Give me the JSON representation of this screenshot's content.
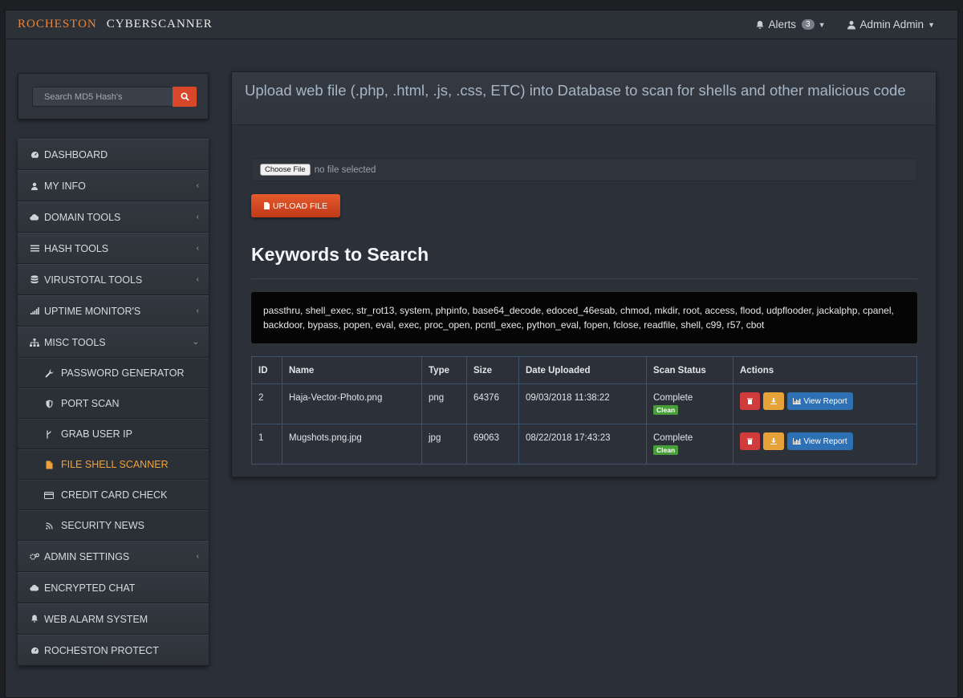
{
  "brand": {
    "part1": "ROCHESTON",
    "part2": "CYBERSCANNER"
  },
  "navbar": {
    "alerts_label": "Alerts",
    "alerts_count": "3",
    "user_label": "Admin Admin"
  },
  "search": {
    "placeholder": "Search MD5 Hash's"
  },
  "sidebar": {
    "items": [
      {
        "label": "DASHBOARD",
        "icon": "dashboard-icon"
      },
      {
        "label": "MY INFO",
        "icon": "user-icon"
      },
      {
        "label": "DOMAIN TOOLS",
        "icon": "cloud-icon"
      },
      {
        "label": "HASH TOOLS",
        "icon": "bars-icon"
      },
      {
        "label": "VIRUSTOTAL TOOLS",
        "icon": "database-icon"
      },
      {
        "label": "UPTIME MONITOR'S",
        "icon": "signal-icon"
      },
      {
        "label": "MISC TOOLS",
        "icon": "sitemap-icon"
      }
    ],
    "sub_items": [
      {
        "label": "PASSWORD GENERATOR",
        "icon": "wrench-icon"
      },
      {
        "label": "PORT SCAN",
        "icon": "shield-icon"
      },
      {
        "label": "GRAB USER IP",
        "icon": "branch-icon"
      },
      {
        "label": "FILE SHELL SCANNER",
        "icon": "file-icon"
      },
      {
        "label": "CREDIT CARD CHECK",
        "icon": "credit-card-icon"
      },
      {
        "label": "SECURITY NEWS",
        "icon": "rss-icon"
      }
    ],
    "bottom_items": [
      {
        "label": "ADMIN SETTINGS",
        "icon": "gears-icon"
      },
      {
        "label": "ENCRYPTED CHAT",
        "icon": "cloud-icon"
      },
      {
        "label": "WEB ALARM SYSTEM",
        "icon": "bell-icon"
      },
      {
        "label": "ROCHESTON PROTECT",
        "icon": "dashboard-icon"
      }
    ]
  },
  "panel": {
    "title": "Upload web file (.php, .html, .js, .css, ETC) into Database to scan for shells and other malicious code",
    "choose_file_label": "Choose File",
    "no_file_text": "no file selected",
    "upload_label": "UPLOAD FILE",
    "keywords_title": "Keywords to Search",
    "keywords": "passthru, shell_exec, str_rot13, system, phpinfo, base64_decode, edoced_46esab, chmod, mkdir, root, access, flood, udpflooder, jackalphp, cpanel, backdoor, bypass, popen, eval, exec, proc_open, pcntl_exec, python_eval, fopen, fclose, readfile, shell, c99, r57, cbot"
  },
  "table": {
    "headers": [
      "ID",
      "Name",
      "Type",
      "Size",
      "Date Uploaded",
      "Scan Status",
      "Actions"
    ],
    "rows": [
      {
        "id": "2",
        "name": "Haja-Vector-Photo.png",
        "type": "png",
        "size": "64376",
        "date": "09/03/2018 11:38:22",
        "status": "Complete",
        "badge": "Clean"
      },
      {
        "id": "1",
        "name": "Mugshots.png.jpg",
        "type": "jpg",
        "size": "69063",
        "date": "08/22/2018 17:43:23",
        "status": "Complete",
        "badge": "Clean"
      }
    ],
    "view_report_label": "View Report"
  },
  "colors": {
    "accent_orange": "#e8843a",
    "active_item": "#f0a23a",
    "upload_button": "#d9472b",
    "clean_badge": "#4a9e3a",
    "report_button": "#2d70b3"
  }
}
